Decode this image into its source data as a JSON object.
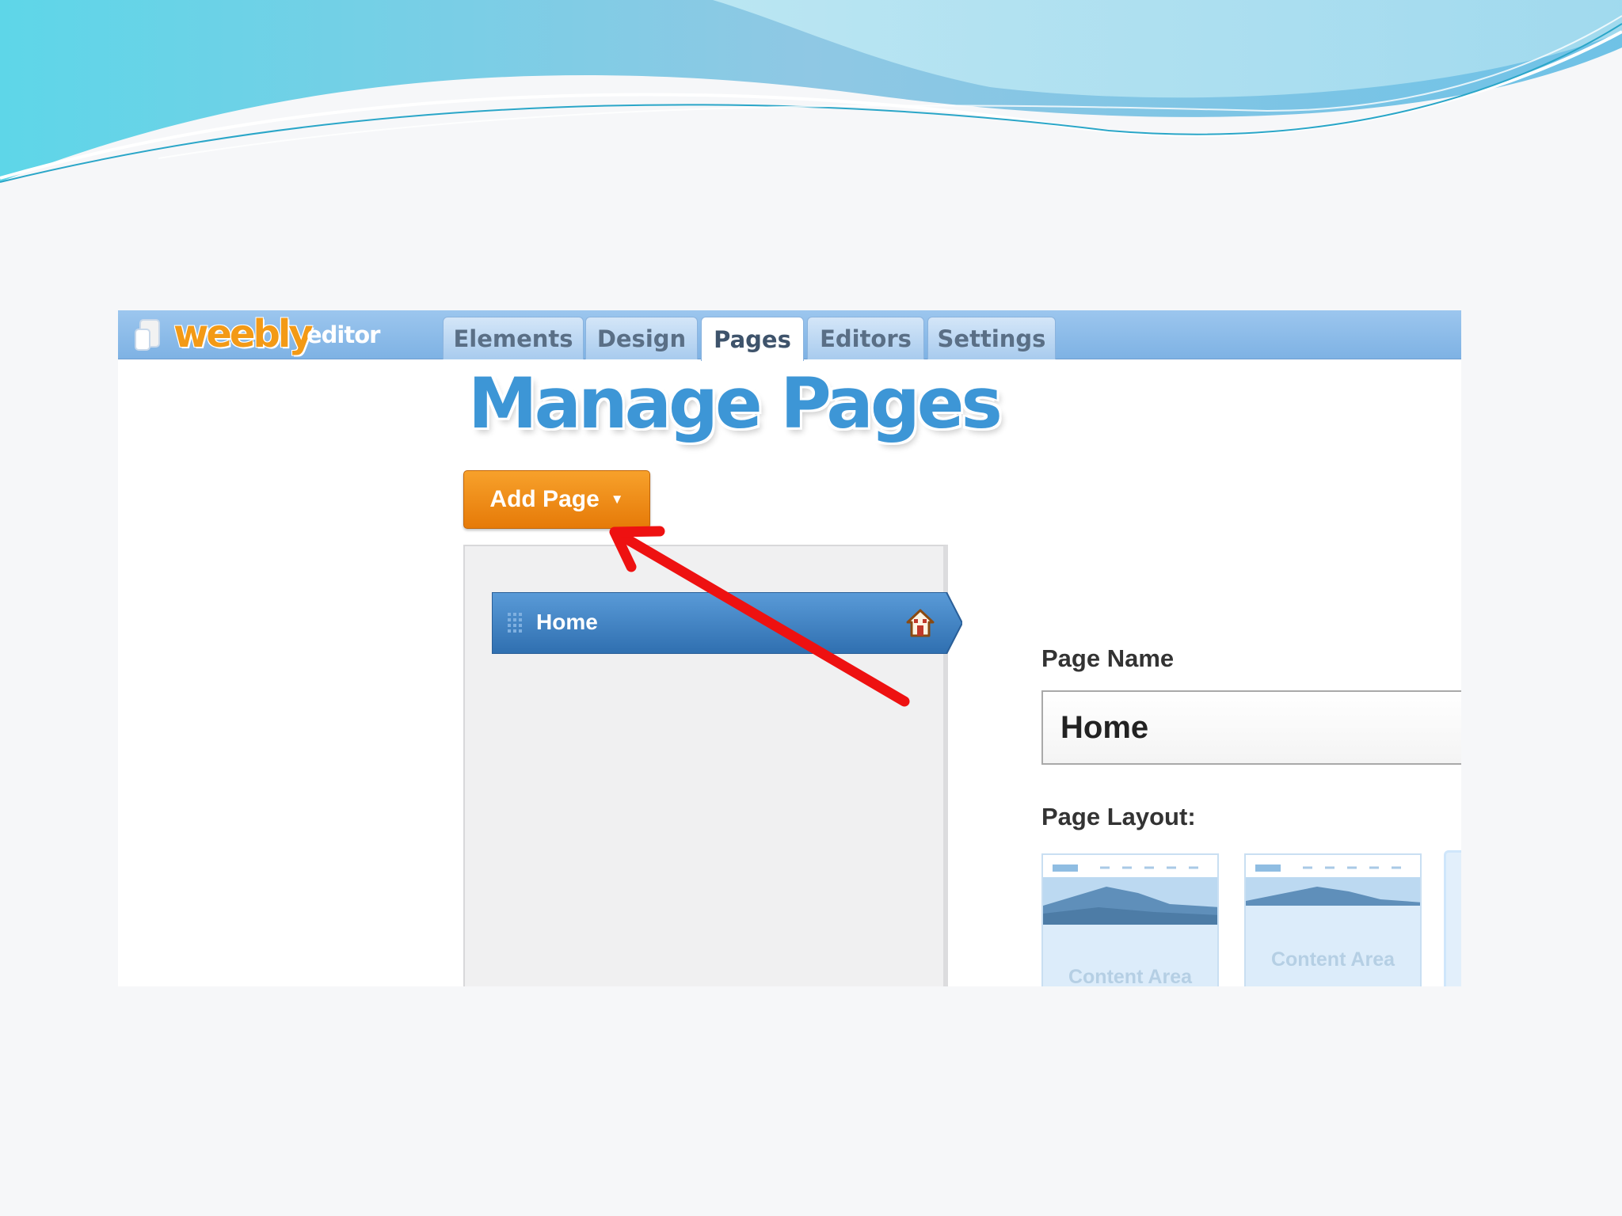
{
  "app": {
    "logo_text": "weebly",
    "logo_suffix": "editor"
  },
  "nav": {
    "tabs": [
      {
        "label": "Elements",
        "active": false
      },
      {
        "label": "Design",
        "active": false
      },
      {
        "label": "Pages",
        "active": true
      },
      {
        "label": "Editors",
        "active": false
      },
      {
        "label": "Settings",
        "active": false
      }
    ]
  },
  "main": {
    "title": "Manage Pages",
    "add_page_label": "Add Page",
    "pages": [
      {
        "label": "Home",
        "is_home": true,
        "selected": true
      }
    ]
  },
  "page_settings": {
    "name_label": "Page Name",
    "name_value": "Home",
    "layout_label": "Page Layout:",
    "layouts": [
      {
        "label": "Content Area"
      },
      {
        "label": "Content Area"
      }
    ]
  },
  "colors": {
    "accent_orange": "#f08c14",
    "title_blue": "#3d96d6",
    "selected_page_blue": "#3f7fbf",
    "annotation_arrow_red": "#ee1111"
  },
  "icons": {
    "logo": "weebly-logo-icon",
    "dropdown": "caret-down-icon",
    "drag": "drag-handle-icon",
    "home": "home-icon",
    "annotation": "red-arrow-icon"
  }
}
